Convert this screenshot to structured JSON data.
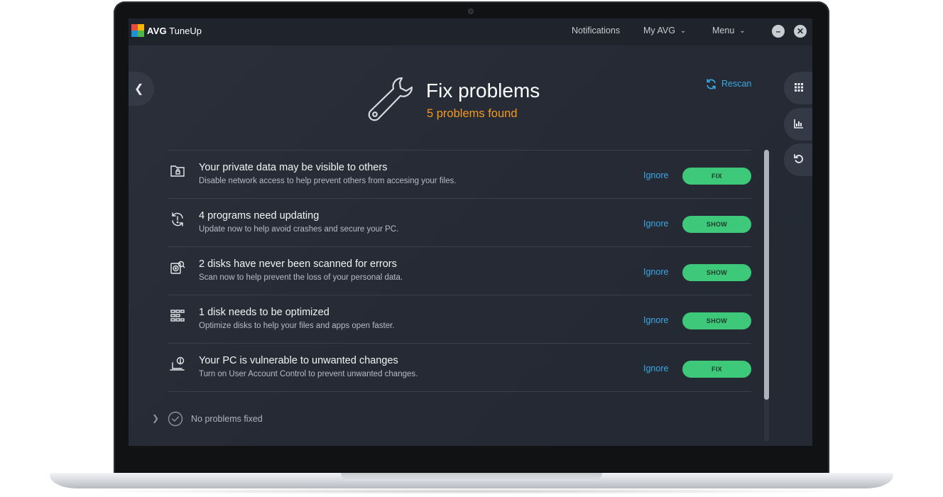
{
  "app": {
    "brand_bold": "AVG",
    "brand_name": "TuneUp"
  },
  "titlebar": {
    "notifications": "Notifications",
    "my_avg": "My AVG",
    "menu": "Menu"
  },
  "header": {
    "title": "Fix problems",
    "subtitle": "5 problems found",
    "rescan": "Rescan"
  },
  "problems": [
    {
      "title": "Your private data may be visible to others",
      "desc": "Disable network access to help prevent others from accesing your files.",
      "ignore": "Ignore",
      "action": "FIX",
      "icon": "folder-lock-icon"
    },
    {
      "title": "4 programs need updating",
      "desc": "Update now to help avoid crashes and secure your PC.",
      "ignore": "Ignore",
      "action": "SHOW",
      "icon": "update-alert-icon"
    },
    {
      "title": "2 disks have never been scanned for errors",
      "desc": "Scan now to help prevent the loss of your personal data.",
      "ignore": "Ignore",
      "action": "SHOW",
      "icon": "disk-scan-icon"
    },
    {
      "title": "1 disk needs to be optimized",
      "desc": "Optimize disks to help your files and apps open faster.",
      "ignore": "Ignore",
      "action": "SHOW",
      "icon": "disk-optimize-icon"
    },
    {
      "title": "Your PC is vulnerable to unwanted changes",
      "desc": "Turn on User Account Control to prevent unwanted changes.",
      "ignore": "Ignore",
      "action": "FIX",
      "icon": "pc-warning-icon"
    }
  ],
  "footer": {
    "text": "No problems fixed"
  },
  "colors": {
    "accent_blue": "#3aa8e3",
    "accent_orange": "#f39a1e",
    "action_green": "#3ec87a"
  }
}
